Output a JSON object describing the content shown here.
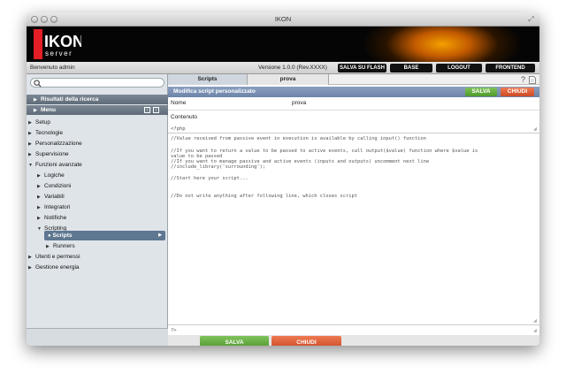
{
  "window": {
    "title": "IKON"
  },
  "brand": {
    "logo_main": "IKON",
    "logo_sub": "server",
    "accent": "#e31e24"
  },
  "topbar": {
    "welcome": "Benvenuto admin",
    "version": "Versione 1.0.0 (Rev.XXXX)",
    "buttons": [
      "SALVA SU FLASH",
      "BASE",
      "LOGOUT",
      "FRONTEND"
    ]
  },
  "sidebar": {
    "search_icon": "search-icon",
    "results_header": "Risultati della ricerca",
    "menu_header": "Menu",
    "items": [
      {
        "label": "Setup"
      },
      {
        "label": "Tecnologie"
      },
      {
        "label": "Personalizzazione"
      },
      {
        "label": "Supervisione"
      },
      {
        "label": "Funzioni avanzate"
      },
      {
        "label": "Logiche"
      },
      {
        "label": "Condizioni"
      },
      {
        "label": "Variabili"
      },
      {
        "label": "Integratori"
      },
      {
        "label": "Notifiche"
      },
      {
        "label": "Scripting"
      },
      {
        "label": "Scripts"
      },
      {
        "label": "Runners"
      },
      {
        "label": "Utenti e permessi"
      },
      {
        "label": "Gestione energia"
      }
    ]
  },
  "main": {
    "tabs": [
      {
        "label": "Scripts"
      },
      {
        "label": "prova"
      }
    ],
    "panel_title": "Modifica script personalizzato",
    "save_label": "SALVA",
    "close_label": "CHIUDI",
    "name_label": "Nome",
    "name_value": "prova",
    "content_label": "Contenuto",
    "code_open": "<?php",
    "code_lines": [
      "//Value received from passive event in execution is available by calling input() function",
      "//If you want to return a value to be passed to active events, call output($value) function where $value is",
      "value to be passed",
      "//If you want to manage passive and active events (inputs and outputs) uncomment next line",
      "//include_library('surrounding');",
      "//Start here your script...",
      "//Do not write anything after following line, which closes script"
    ],
    "code_close": "?>"
  }
}
